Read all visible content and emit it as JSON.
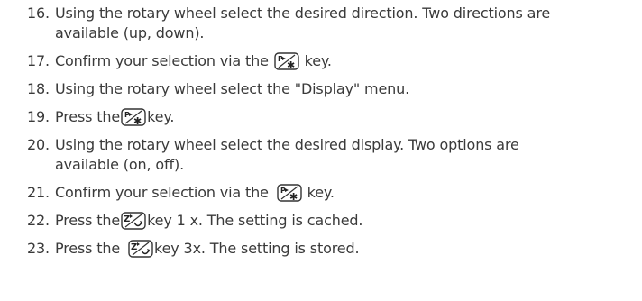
{
  "steps": [
    {
      "num": "16.",
      "lines": [
        "Using the rotary wheel select the desired direction. Two directions are",
        "available (up, down)."
      ]
    },
    {
      "num": "17.",
      "before": "Confirm your selection via the",
      "key": "p-star-key-icon",
      "after": "key."
    },
    {
      "num": "18.",
      "text": "Using the rotary wheel select the \"Display\" menu."
    },
    {
      "num": "19.",
      "before": "Press the",
      "key": "p-star-key-icon",
      "after": "key."
    },
    {
      "num": "20.",
      "lines": [
        "Using the rotary wheel select the desired display. Two options are",
        "available (on, off)."
      ]
    },
    {
      "num": "21.",
      "before": "Confirm your selection via the",
      "key": "p-star-key-icon",
      "after": "key."
    },
    {
      "num": "22.",
      "before": "Press the",
      "key": "z-return-key-icon",
      "after": "key 1 x. The setting is cached."
    },
    {
      "num": "23.",
      "before": "Press the",
      "key": "z-return-key-icon",
      "after": "key 3x. The setting is stored."
    }
  ]
}
